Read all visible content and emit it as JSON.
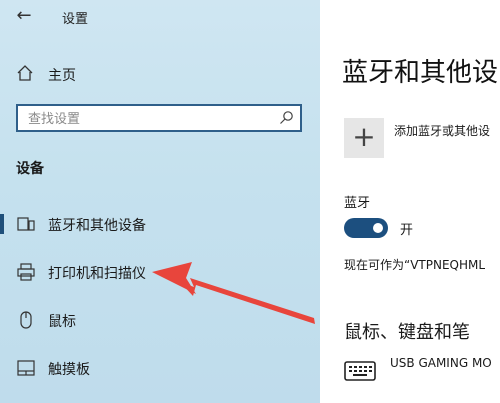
{
  "window": {
    "title": "设置"
  },
  "sidebar": {
    "home_label": "主页",
    "search": {
      "placeholder": "查找设置"
    },
    "section_label": "设备",
    "items": [
      {
        "label": "蓝牙和其他设备",
        "icon": "bluetooth-devices-icon",
        "active": true
      },
      {
        "label": "打印机和扫描仪",
        "icon": "printer-icon",
        "active": false
      },
      {
        "label": "鼠标",
        "icon": "mouse-icon",
        "active": false
      },
      {
        "label": "触摸板",
        "icon": "touchpad-icon",
        "active": false
      }
    ]
  },
  "main": {
    "title": "蓝牙和其他设",
    "add_label": "添加蓝牙或其他设",
    "bluetooth": {
      "heading": "蓝牙",
      "toggle_state": "开",
      "on": true
    },
    "discoverable": "现在可作为“VTPNEQHML",
    "section_title": "鼠标、键盘和笔",
    "devices": [
      {
        "label": "USB GAMING MO",
        "icon": "keyboard-icon"
      }
    ]
  },
  "colors": {
    "accent": "#1c4f7f",
    "annotation_arrow": "#e8453c"
  }
}
